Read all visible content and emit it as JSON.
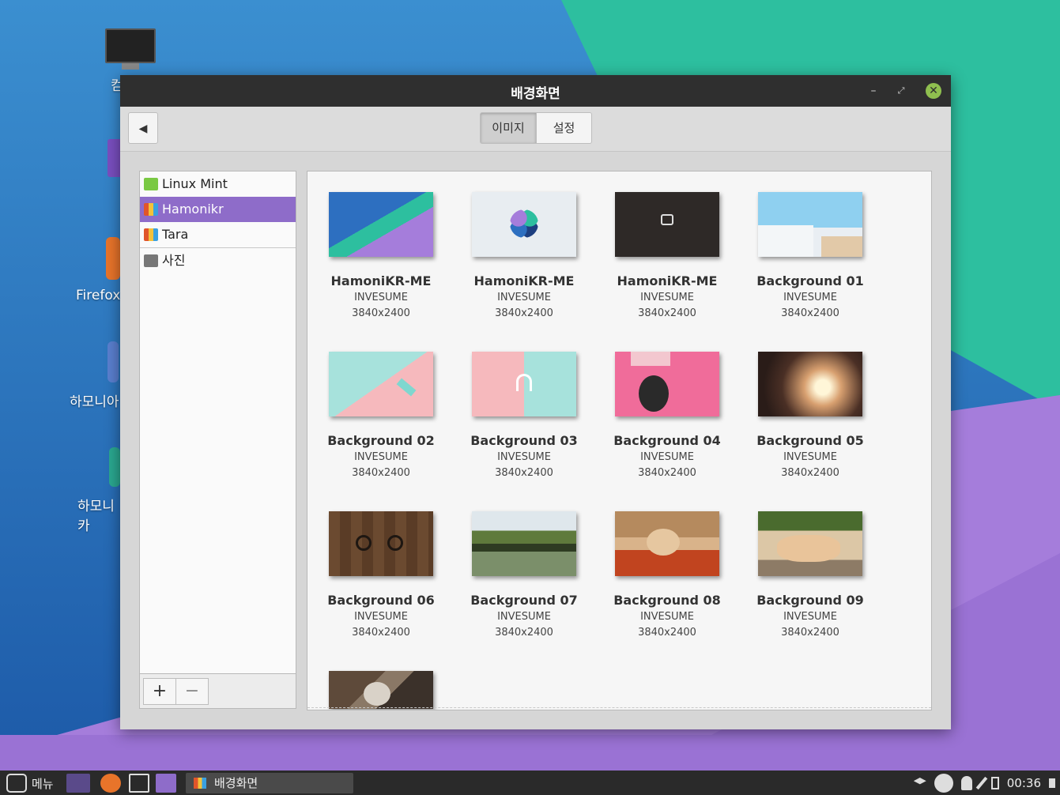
{
  "window": {
    "title": "배경화면",
    "minimize_glyph": "–",
    "maximize_glyph": "⤢",
    "close_glyph": "✕"
  },
  "toolbar": {
    "back_glyph": "◀",
    "tabs": [
      {
        "label": "이미지",
        "active": true
      },
      {
        "label": "설정",
        "active": false
      }
    ]
  },
  "sidebar": {
    "items": [
      {
        "label": "Linux Mint",
        "icon": "mint-folder-icon",
        "color": "#7ac943"
      },
      {
        "label": "Hamonikr",
        "icon": "image-folder-icon",
        "color": "#e0552a",
        "selected": true
      },
      {
        "label": "Tara",
        "icon": "image-folder-icon",
        "color": "#e0552a"
      },
      {
        "label": "사진",
        "icon": "camera-folder-icon",
        "color": "#777777"
      }
    ],
    "add_label": "+",
    "remove_label": "−"
  },
  "wallpapers": [
    {
      "name": "HamoniKR-ME",
      "author": "INVESUME",
      "resolution": "3840x2400"
    },
    {
      "name": "HamoniKR-ME",
      "author": "INVESUME",
      "resolution": "3840x2400"
    },
    {
      "name": "HamoniKR-ME",
      "author": "INVESUME",
      "resolution": "3840x2400"
    },
    {
      "name": "Background 01",
      "author": "INVESUME",
      "resolution": "3840x2400"
    },
    {
      "name": "Background 02",
      "author": "INVESUME",
      "resolution": "3840x2400"
    },
    {
      "name": "Background 03",
      "author": "INVESUME",
      "resolution": "3840x2400"
    },
    {
      "name": "Background 04",
      "author": "INVESUME",
      "resolution": "3840x2400"
    },
    {
      "name": "Background 05",
      "author": "INVESUME",
      "resolution": "3840x2400"
    },
    {
      "name": "Background 06",
      "author": "INVESUME",
      "resolution": "3840x2400"
    },
    {
      "name": "Background 07",
      "author": "INVESUME",
      "resolution": "3840x2400"
    },
    {
      "name": "Background 08",
      "author": "INVESUME",
      "resolution": "3840x2400"
    },
    {
      "name": "Background 09",
      "author": "INVESUME",
      "resolution": "3840x2400"
    }
  ],
  "desktop_icons": [
    {
      "label": "컴",
      "icon": "computer-icon"
    },
    {
      "label": "",
      "icon": "home-folder-icon"
    },
    {
      "label": "Firefox",
      "icon": "firefox-icon"
    },
    {
      "label": "하모니아",
      "icon": "app-icon"
    },
    {
      "label": "하모니카",
      "icon": "hamonikr-icon"
    }
  ],
  "taskbar": {
    "menu_label": "메뉴",
    "window_label": "배경화면",
    "clock": "00:36"
  },
  "colors": {
    "accent": "#8e6cc9",
    "titlebar": "#2f2f2f",
    "close": "#8fbf4f"
  }
}
